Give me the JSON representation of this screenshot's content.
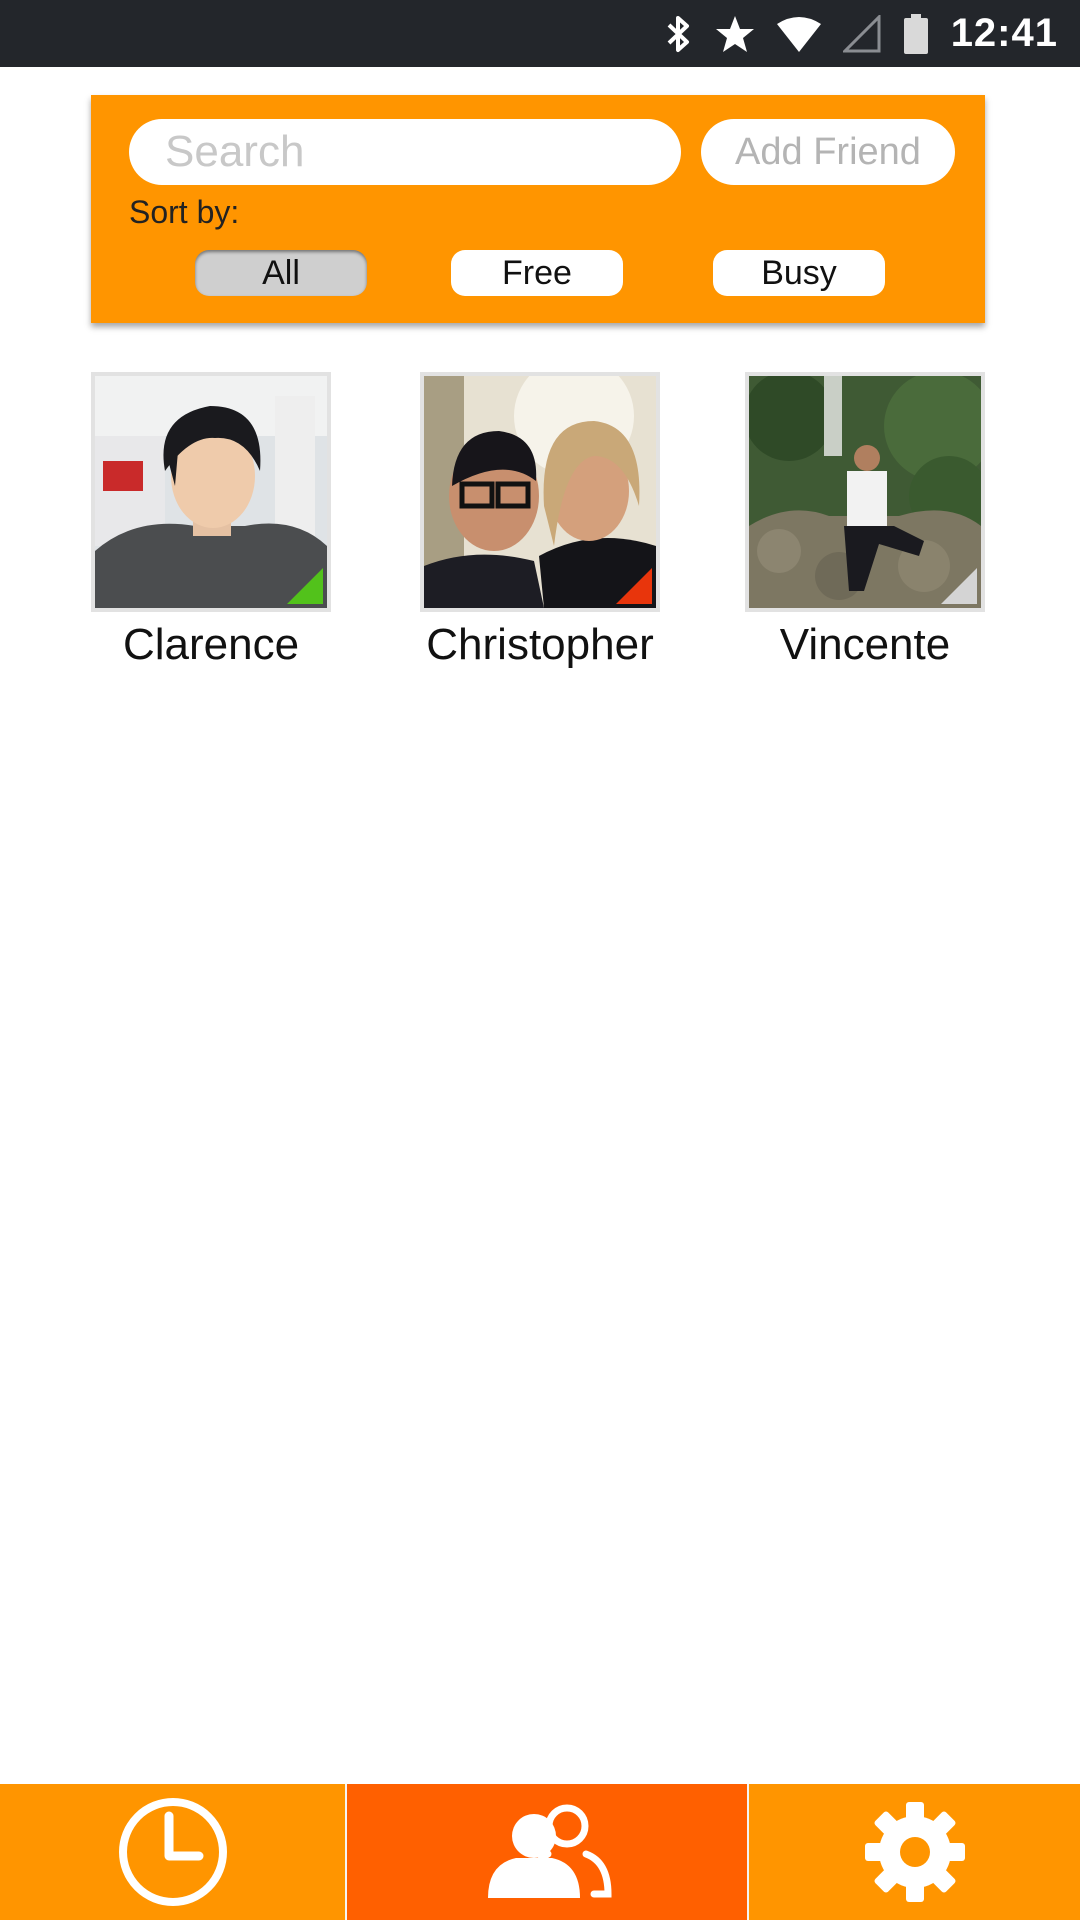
{
  "status_bar": {
    "time": "12:41",
    "icons": [
      "bluetooth-icon",
      "star-icon",
      "wifi-icon",
      "cell-signal-icon",
      "battery-icon"
    ]
  },
  "search_panel": {
    "search_placeholder": "Search",
    "add_friend_label": "Add Friend",
    "sort_label": "Sort by:",
    "filters": [
      {
        "label": "All",
        "selected": true
      },
      {
        "label": "Free",
        "selected": false
      },
      {
        "label": "Busy",
        "selected": false
      }
    ]
  },
  "friends": [
    {
      "name": "Clarence",
      "status": "free"
    },
    {
      "name": "Christopher",
      "status": "busy"
    },
    {
      "name": "Vincente",
      "status": "unknown"
    }
  ],
  "tabs": [
    {
      "icon": "clock-icon",
      "selected": false
    },
    {
      "icon": "friends-icon",
      "selected": true
    },
    {
      "icon": "gear-icon",
      "selected": false
    }
  ],
  "colors": {
    "accent": "#ff9500",
    "accent_selected": "#ff6000",
    "status_free": "#52c21b",
    "status_busy": "#e8350c",
    "status_unknown": "#d4d4d4",
    "status_bar": "#23262b"
  }
}
